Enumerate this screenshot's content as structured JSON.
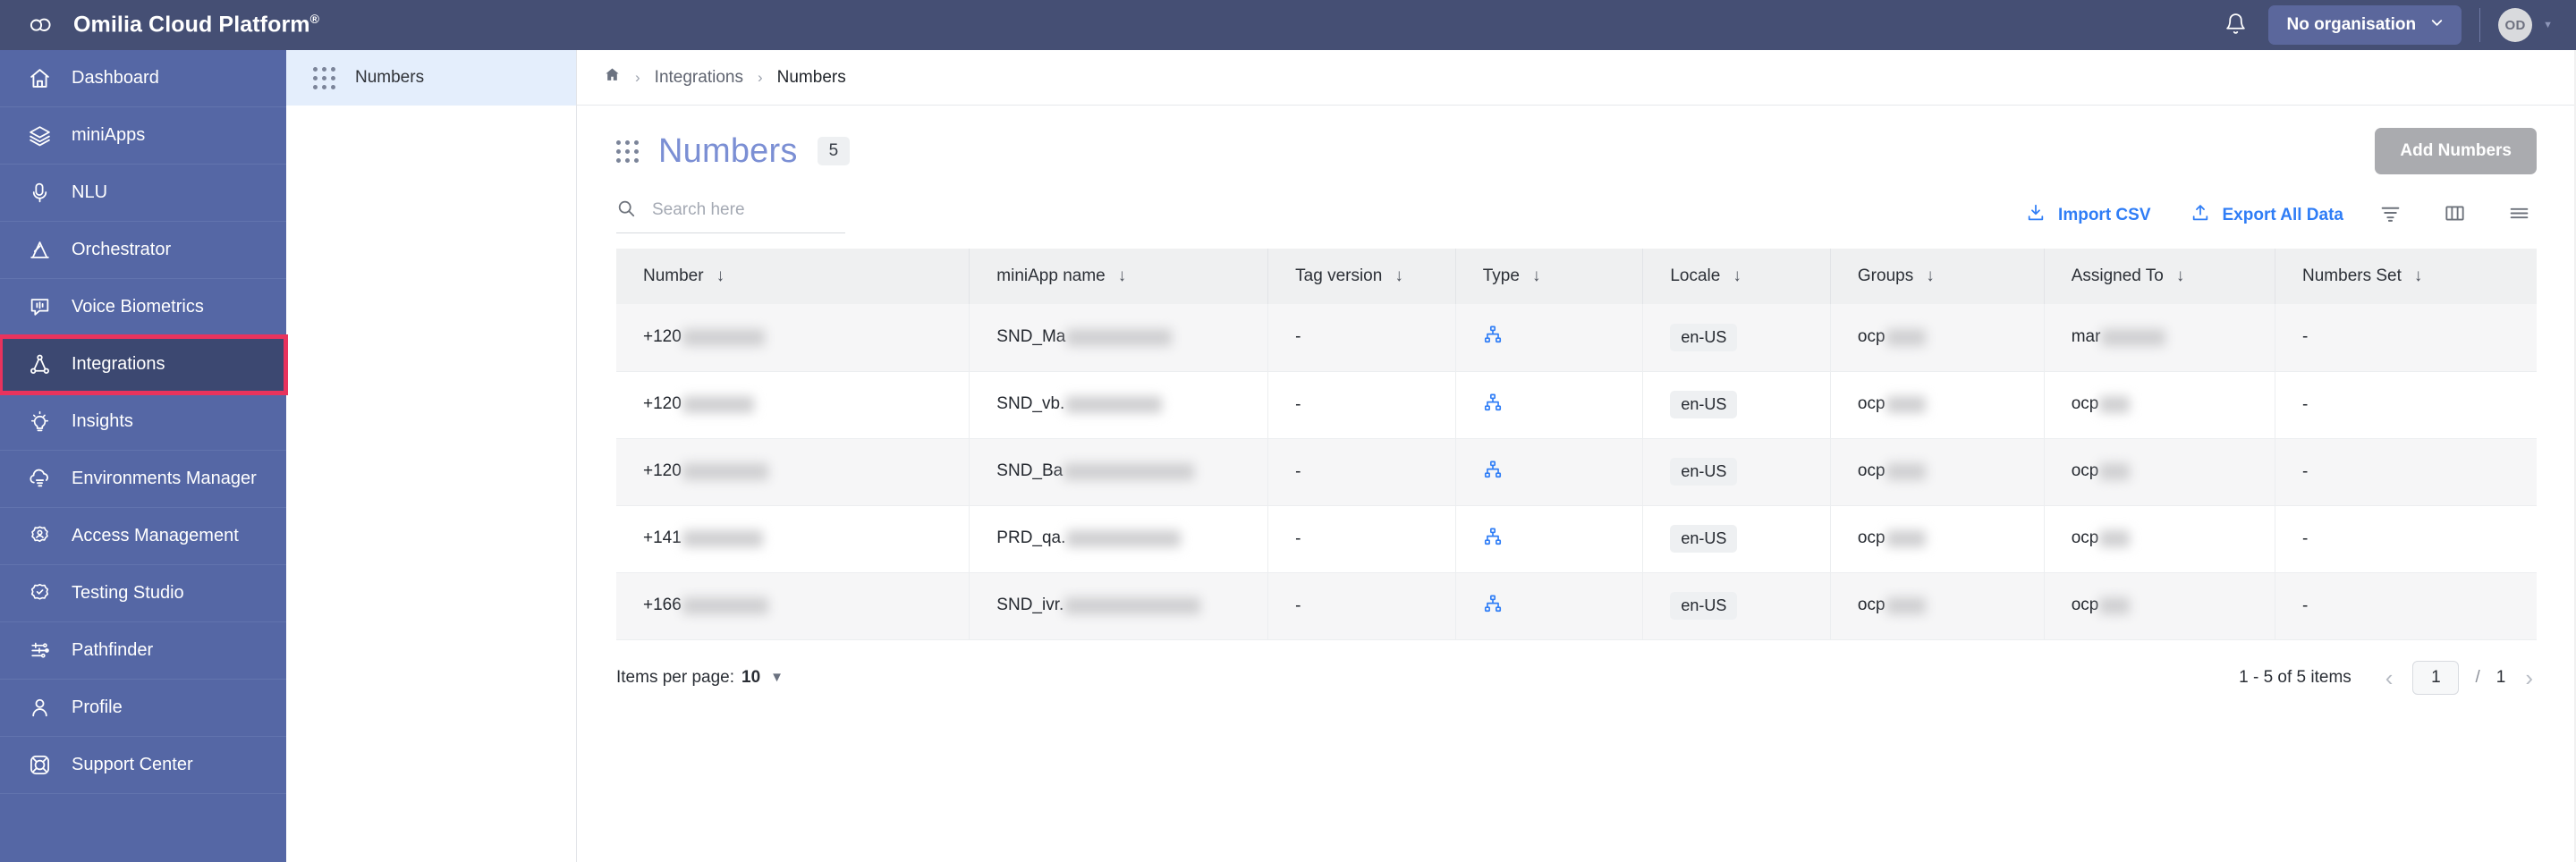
{
  "topbar": {
    "logo_icon": "omilia-cloud-logo-icon",
    "brand_name": "Omilia Cloud Platform",
    "brand_registered_mark": "®",
    "notifications_icon": "bell-icon",
    "organisation_label": "No organisation",
    "organisation_caret_icon": "chevron-down-icon",
    "avatar_initials": "OD",
    "avatar_caret_icon": "caret-down-icon"
  },
  "sidebar": {
    "items": [
      {
        "label": "Dashboard",
        "icon": "home-icon"
      },
      {
        "label": "miniApps",
        "icon": "layers-icon"
      },
      {
        "label": "NLU",
        "icon": "microphone-icon"
      },
      {
        "label": "Orchestrator",
        "icon": "orchestrator-icon"
      },
      {
        "label": "Voice Biometrics",
        "icon": "voice-wave-icon"
      },
      {
        "label": "Integrations",
        "icon": "integrations-node-icon"
      },
      {
        "label": "Insights",
        "icon": "lightbulb-icon"
      },
      {
        "label": "Environments Manager",
        "icon": "cloud-settings-icon"
      },
      {
        "label": "Access Management",
        "icon": "user-gear-icon"
      },
      {
        "label": "Testing Studio",
        "icon": "badge-check-icon"
      },
      {
        "label": "Pathfinder",
        "icon": "pathfinder-icon"
      },
      {
        "label": "Profile",
        "icon": "user-icon"
      },
      {
        "label": "Support Center",
        "icon": "lifebuoy-icon"
      }
    ],
    "active_index": 5,
    "highlight_index": 5,
    "highlight_color": "#e8335d"
  },
  "subpanel": {
    "items": [
      {
        "label": "Numbers",
        "icon": "grid-dots-icon"
      }
    ],
    "active_index": 0
  },
  "breadcrumb": {
    "home_icon": "home-icon",
    "separator": "›",
    "items": [
      "Integrations",
      "Numbers"
    ]
  },
  "page": {
    "drag_handle_icon": "grid-dots-icon",
    "title": "Numbers",
    "count": "5",
    "add_button_label": "Add Numbers",
    "add_button_disabled": true
  },
  "search": {
    "icon": "search-icon",
    "placeholder": "Search here",
    "value": ""
  },
  "toolbar": {
    "import_label": "Import CSV",
    "import_icon": "download-icon",
    "export_label": "Export All Data",
    "export_icon": "upload-icon",
    "filter_icon": "filter-icon",
    "columns_icon": "columns-icon",
    "menu_icon": "list-menu-icon"
  },
  "table": {
    "columns": [
      {
        "label": "Number",
        "sort_icon": "sort-down-arrow-icon"
      },
      {
        "label": "miniApp name",
        "sort_icon": "sort-down-arrow-icon"
      },
      {
        "label": "Tag version",
        "sort_icon": "sort-down-arrow-icon"
      },
      {
        "label": "Type",
        "sort_icon": "sort-down-arrow-icon"
      },
      {
        "label": "Locale",
        "sort_icon": "sort-down-arrow-icon"
      },
      {
        "label": "Groups",
        "sort_icon": "sort-down-arrow-icon"
      },
      {
        "label": "Assigned To",
        "sort_icon": "sort-down-arrow-icon"
      },
      {
        "label": "Numbers Set",
        "sort_icon": "sort-down-arrow-icon"
      }
    ],
    "rows": [
      {
        "number_prefix": "+120",
        "number_redacted_width": 92,
        "miniapp_prefix": "SND_Ma",
        "miniapp_redacted_width": 118,
        "tag_version": "-",
        "type_icon": "hierarchy-icon",
        "locale": "en-US",
        "groups_prefix": "ocp",
        "groups_redacted_width": 44,
        "assigned_prefix": "mar",
        "assigned_redacted_width": 72,
        "numbers_set": "-"
      },
      {
        "number_prefix": "+120",
        "number_redacted_width": 80,
        "miniapp_prefix": "SND_vb.",
        "miniapp_redacted_width": 108,
        "tag_version": "-",
        "type_icon": "hierarchy-icon",
        "locale": "en-US",
        "groups_prefix": "ocp",
        "groups_redacted_width": 44,
        "assigned_prefix": "ocp",
        "assigned_redacted_width": 34,
        "numbers_set": "-"
      },
      {
        "number_prefix": "+120",
        "number_redacted_width": 96,
        "miniapp_prefix": "SND_Ba",
        "miniapp_redacted_width": 146,
        "tag_version": "-",
        "type_icon": "hierarchy-icon",
        "locale": "en-US",
        "groups_prefix": "ocp",
        "groups_redacted_width": 44,
        "assigned_prefix": "ocp",
        "assigned_redacted_width": 34,
        "numbers_set": "-"
      },
      {
        "number_prefix": "+141",
        "number_redacted_width": 90,
        "miniapp_prefix": "PRD_qa.",
        "miniapp_redacted_width": 128,
        "tag_version": "-",
        "type_icon": "hierarchy-icon",
        "locale": "en-US",
        "groups_prefix": "ocp",
        "groups_redacted_width": 44,
        "assigned_prefix": "ocp",
        "assigned_redacted_width": 34,
        "numbers_set": "-"
      },
      {
        "number_prefix": "+166",
        "number_redacted_width": 96,
        "miniapp_prefix": "SND_ivr.",
        "miniapp_redacted_width": 152,
        "tag_version": "-",
        "type_icon": "hierarchy-icon",
        "locale": "en-US",
        "groups_prefix": "ocp",
        "groups_redacted_width": 44,
        "assigned_prefix": "ocp",
        "assigned_redacted_width": 34,
        "numbers_set": "-"
      }
    ]
  },
  "footer": {
    "items_per_page_label": "Items per page:",
    "items_per_page_value": "10",
    "items_per_page_caret": "caret-down-icon",
    "range_text": "1 - 5 of 5 items",
    "prev_icon": "chevron-left-icon",
    "next_icon": "chevron-right-icon",
    "current_page": "1",
    "page_separator": "/",
    "total_pages": "1"
  },
  "colors": {
    "topbar_bg": "#454f74",
    "sidebar_bg": "#5567a5",
    "sidebar_active_bg": "#3c4871",
    "accent_blue": "#2f7df6",
    "title_blue": "#7b8fd4",
    "highlight_red": "#e8335d"
  }
}
